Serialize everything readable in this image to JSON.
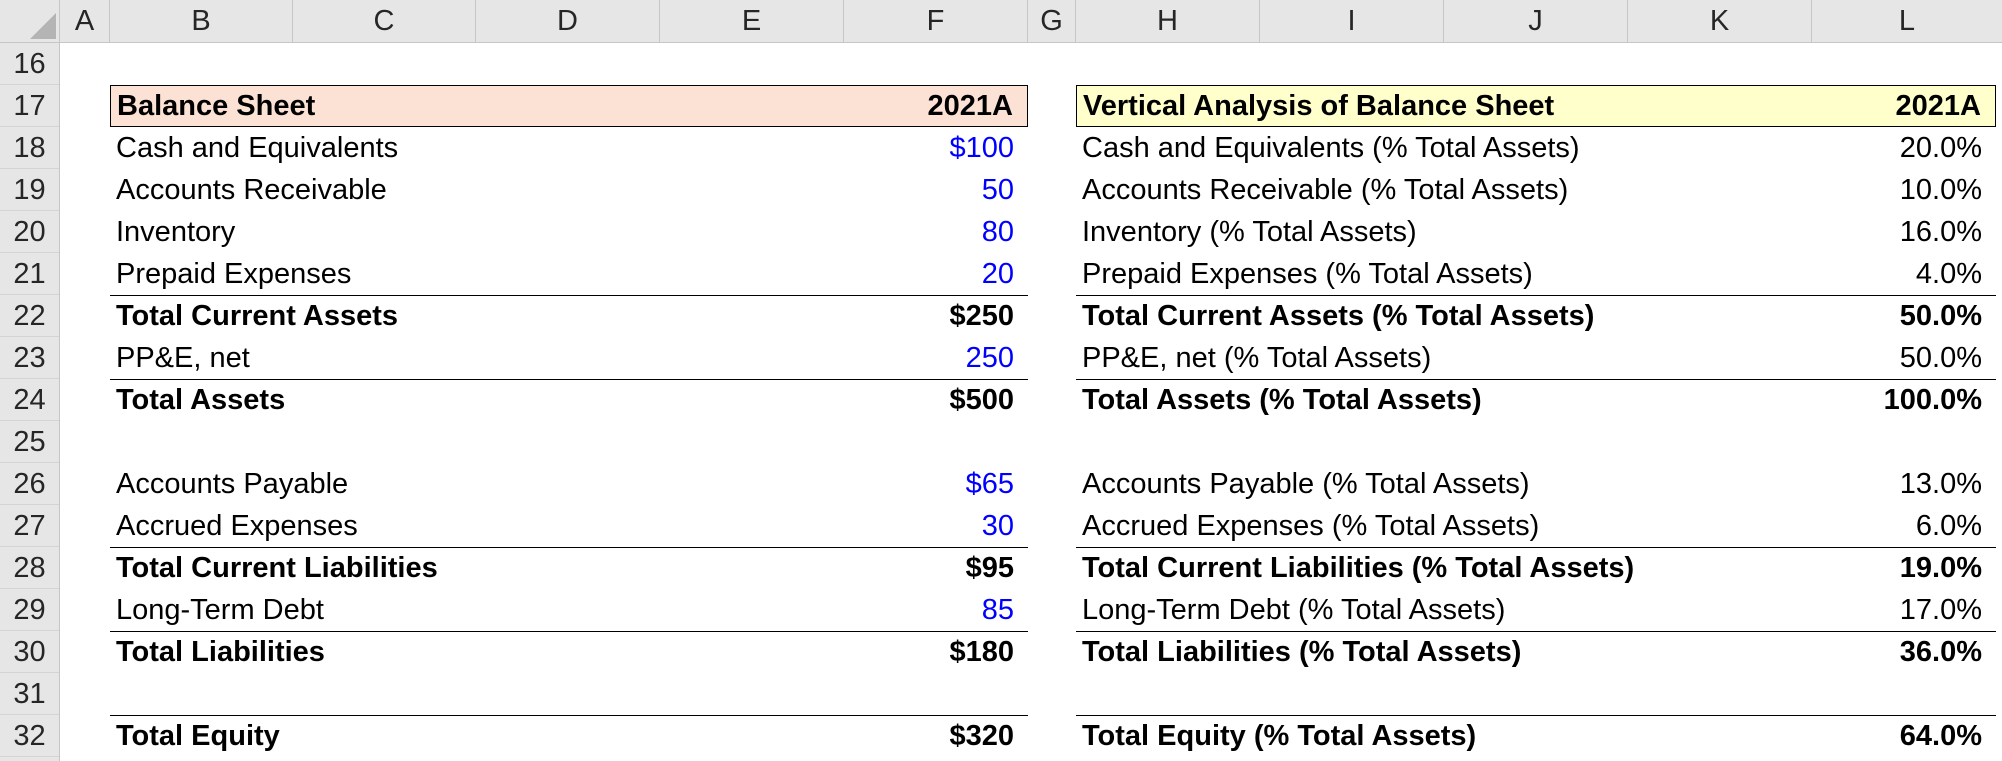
{
  "columns": [
    "A",
    "B",
    "C",
    "D",
    "E",
    "F",
    "G",
    "H",
    "I",
    "J",
    "K",
    "L"
  ],
  "rows": [
    "16",
    "17",
    "18",
    "19",
    "20",
    "21",
    "22",
    "23",
    "24",
    "25",
    "26",
    "27",
    "28",
    "29",
    "30",
    "31",
    "32"
  ],
  "balance_sheet": {
    "title": "Balance Sheet",
    "period": "2021A",
    "header_color": "#fbe2d5",
    "input_color": "#0000ff",
    "lines": [
      {
        "label": "Cash and Equivalents",
        "value": "$100"
      },
      {
        "label": "Accounts Receivable",
        "value": "50"
      },
      {
        "label": "Inventory",
        "value": "80"
      },
      {
        "label": "Prepaid Expenses",
        "value": "20"
      },
      {
        "label": "Total Current Assets",
        "value": "$250"
      },
      {
        "label": "PP&E, net",
        "value": "250"
      },
      {
        "label": "Total Assets",
        "value": "$500"
      },
      {
        "label": "Accounts Payable",
        "value": "$65"
      },
      {
        "label": "Accrued Expenses",
        "value": "30"
      },
      {
        "label": "Total Current Liabilities",
        "value": "$95"
      },
      {
        "label": "Long-Term Debt",
        "value": "85"
      },
      {
        "label": "Total Liabilities",
        "value": "$180"
      },
      {
        "label": "Total Equity",
        "value": "$320"
      }
    ]
  },
  "vertical_analysis": {
    "title": "Vertical Analysis of Balance Sheet",
    "period": "2021A",
    "header_color": "#ffffcc",
    "lines": [
      {
        "label": "Cash and Equivalents (% Total Assets)",
        "value": "20.0%"
      },
      {
        "label": "Accounts Receivable (% Total Assets)",
        "value": "10.0%"
      },
      {
        "label": "Inventory (% Total Assets)",
        "value": "16.0%"
      },
      {
        "label": "Prepaid Expenses (% Total Assets)",
        "value": "4.0%"
      },
      {
        "label": "Total Current Assets (% Total Assets)",
        "value": "50.0%"
      },
      {
        "label": "PP&E, net (% Total Assets)",
        "value": "50.0%"
      },
      {
        "label": "Total Assets (% Total Assets)",
        "value": "100.0%"
      },
      {
        "label": "Accounts Payable (% Total Assets)",
        "value": "13.0%"
      },
      {
        "label": "Accrued Expenses (% Total Assets)",
        "value": "6.0%"
      },
      {
        "label": "Total Current Liabilities (% Total Assets)",
        "value": "19.0%"
      },
      {
        "label": "Long-Term Debt (% Total Assets)",
        "value": "17.0%"
      },
      {
        "label": "Total Liabilities (% Total Assets)",
        "value": "36.0%"
      },
      {
        "label": "Total Equity (% Total Assets)",
        "value": "64.0%"
      }
    ]
  }
}
